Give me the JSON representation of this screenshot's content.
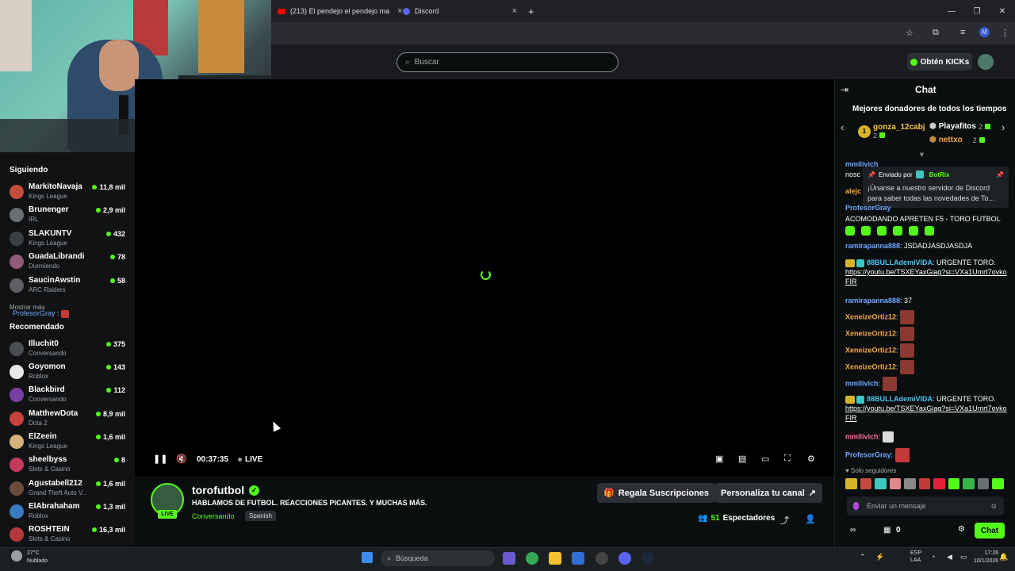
{
  "browser": {
    "tabs": [
      {
        "label": "(213) El pendejo el pendejo ma"
      },
      {
        "label": "Discord"
      }
    ],
    "new_tab": "+",
    "profile_initial": "M"
  },
  "header": {
    "search_placeholder": "Buscar",
    "kicks_button": "Obtén KICKs"
  },
  "sidebar": {
    "following_title": "Siguiendo",
    "following": [
      {
        "name": "MarkitoNavaja",
        "category": "Kings League",
        "viewers": "11,8 mil",
        "color": "#c44c3a"
      },
      {
        "name": "Brunenger",
        "category": "IRL",
        "viewers": "2,9 mil",
        "color": "#6b6f75"
      },
      {
        "name": "SLAKUNTV",
        "category": "Kings League",
        "viewers": "432",
        "color": "#3b3f44"
      },
      {
        "name": "GuadaLibrandi",
        "category": "Durmiendo",
        "viewers": "78",
        "color": "#8f5b78"
      },
      {
        "name": "SaucinAwstin",
        "category": "ARC Raiders",
        "viewers": "58",
        "color": "#5d5f62"
      }
    ],
    "show_more": "Mostrar más",
    "overlay_user": "ProfesorGray",
    "overlay_sep": ":",
    "recommended_title": "Recomendado",
    "recommended": [
      {
        "name": "Illuchit0",
        "category": "Conversando",
        "viewers": "375",
        "color": "#4a4d52"
      },
      {
        "name": "Goyomon",
        "category": "Roblox",
        "viewers": "143",
        "color": "#e8e8e8"
      },
      {
        "name": "Blackbird",
        "category": "Conversando",
        "viewers": "112",
        "color": "#7a3fa3"
      },
      {
        "name": "MatthewDota",
        "category": "Dota 2",
        "viewers": "8,9 mil",
        "color": "#c7423a"
      },
      {
        "name": "ElZeein",
        "category": "Kings League",
        "viewers": "1,6 mil",
        "color": "#d4b27a"
      },
      {
        "name": "sheelbyss",
        "category": "Slots & Casino",
        "viewers": "8",
        "color": "#c43a5a"
      },
      {
        "name": "Agustabell212",
        "category": "Grand Theft Auto V...",
        "viewers": "1,6 mil",
        "color": "#6b4b3a"
      },
      {
        "name": "ElAbrahaham",
        "category": "Roblox",
        "viewers": "1,3 mil",
        "color": "#3a7ac4"
      },
      {
        "name": "ROSHTEIN",
        "category": "Slots & Casino",
        "viewers": "16,3 mil",
        "color": "#b4383a"
      }
    ]
  },
  "player": {
    "time": "00:37:35",
    "live": "LIVE"
  },
  "stream": {
    "channel": "torofutbol",
    "live_badge": "LIVE",
    "title": "HABLAMOS DE FUTBOL. REACCIONES PICANTES. Y MUCHAS MÁS.",
    "category": "Conversando",
    "language": "Spanish",
    "gift_button": "Regala Suscripciones",
    "customize_button": "Personaliza tu canal",
    "viewers_count": "51",
    "viewers_label": "Espectadores"
  },
  "chat": {
    "title": "Chat",
    "donors_title": "Mejores donadores de todos los tiempos",
    "donors": [
      {
        "name": "gonza_12cabj",
        "count": "2"
      },
      {
        "name": "Playafitos",
        "count": "2"
      },
      {
        "name": "nettxo",
        "count": "2"
      }
    ],
    "pinned_by": "Enviado por",
    "pinned_user": "BotRix",
    "pinned_text": "¡Únanse a nuestro servidor de Discord para saber todas las novedades de To...",
    "partial_users": [
      "mmilivich",
      "nosc",
      "alejc",
      "ProfesorGray"
    ],
    "msg1_text": "ACOMODANDO APRETEN F5 - TORO FUTBOL",
    "msg2_user": "ramirapanna888",
    "msg2_text": ": JSDADJASDJASDJA",
    "msg3_user": "88BULLAdemiVIDA",
    "msg3_text": ": URGENTE TORO.",
    "msg3_link": "https://youtu.be/TSXEYaxGiag?si=VXa1Umrt7ovkoFIR",
    "msg4_user": "ramirapanna888",
    "msg4_text": ": 37",
    "xeneize_user": "XeneizeOrtiz12",
    "sep": ":",
    "mmilivich_user": "mmilivich",
    "msg5_user": "88BULLAdemiVIDA",
    "msg5_text": ": URGENTE TORO.",
    "msg5_link": "https://youtu.be/TSXEYaxGiag?si=VXa1Umrt7ovkoFIR",
    "msg6_user": "mmilivich",
    "msg7_user": "ProfesorGray",
    "followers_only": "Solo seguidores",
    "input_placeholder": "Enviar un mensaje",
    "footer_count": "0",
    "chat_button": "Chat",
    "colors": {
      "green": "#53fc18",
      "blue": "#6ea6ff",
      "orange": "#f5a742",
      "pink": "#ff6b9a",
      "teal": "#4ac5f0"
    }
  },
  "taskbar": {
    "weather_temp": "27°C",
    "weather_desc": "Nublado",
    "search": "Búsqueda",
    "lang1": "ESP",
    "lang2": "LAA",
    "time": "17:26",
    "date": "10/1/2026"
  }
}
